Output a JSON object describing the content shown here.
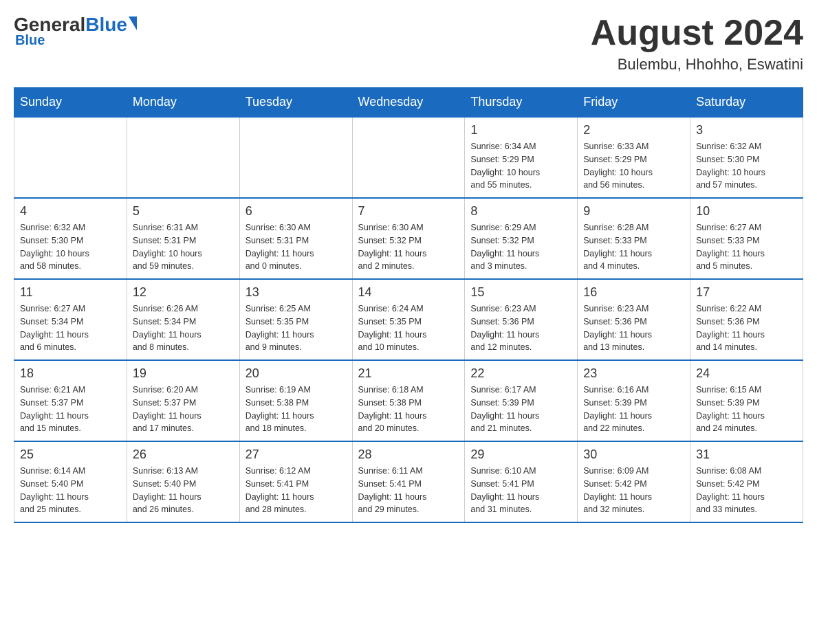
{
  "header": {
    "logo_general": "General",
    "logo_blue": "Blue",
    "month_title": "August 2024",
    "location": "Bulembu, Hhohho, Eswatini"
  },
  "days_of_week": [
    "Sunday",
    "Monday",
    "Tuesday",
    "Wednesday",
    "Thursday",
    "Friday",
    "Saturday"
  ],
  "weeks": [
    {
      "days": [
        {
          "num": "",
          "info": ""
        },
        {
          "num": "",
          "info": ""
        },
        {
          "num": "",
          "info": ""
        },
        {
          "num": "",
          "info": ""
        },
        {
          "num": "1",
          "info": "Sunrise: 6:34 AM\nSunset: 5:29 PM\nDaylight: 10 hours\nand 55 minutes."
        },
        {
          "num": "2",
          "info": "Sunrise: 6:33 AM\nSunset: 5:29 PM\nDaylight: 10 hours\nand 56 minutes."
        },
        {
          "num": "3",
          "info": "Sunrise: 6:32 AM\nSunset: 5:30 PM\nDaylight: 10 hours\nand 57 minutes."
        }
      ]
    },
    {
      "days": [
        {
          "num": "4",
          "info": "Sunrise: 6:32 AM\nSunset: 5:30 PM\nDaylight: 10 hours\nand 58 minutes."
        },
        {
          "num": "5",
          "info": "Sunrise: 6:31 AM\nSunset: 5:31 PM\nDaylight: 10 hours\nand 59 minutes."
        },
        {
          "num": "6",
          "info": "Sunrise: 6:30 AM\nSunset: 5:31 PM\nDaylight: 11 hours\nand 0 minutes."
        },
        {
          "num": "7",
          "info": "Sunrise: 6:30 AM\nSunset: 5:32 PM\nDaylight: 11 hours\nand 2 minutes."
        },
        {
          "num": "8",
          "info": "Sunrise: 6:29 AM\nSunset: 5:32 PM\nDaylight: 11 hours\nand 3 minutes."
        },
        {
          "num": "9",
          "info": "Sunrise: 6:28 AM\nSunset: 5:33 PM\nDaylight: 11 hours\nand 4 minutes."
        },
        {
          "num": "10",
          "info": "Sunrise: 6:27 AM\nSunset: 5:33 PM\nDaylight: 11 hours\nand 5 minutes."
        }
      ]
    },
    {
      "days": [
        {
          "num": "11",
          "info": "Sunrise: 6:27 AM\nSunset: 5:34 PM\nDaylight: 11 hours\nand 6 minutes."
        },
        {
          "num": "12",
          "info": "Sunrise: 6:26 AM\nSunset: 5:34 PM\nDaylight: 11 hours\nand 8 minutes."
        },
        {
          "num": "13",
          "info": "Sunrise: 6:25 AM\nSunset: 5:35 PM\nDaylight: 11 hours\nand 9 minutes."
        },
        {
          "num": "14",
          "info": "Sunrise: 6:24 AM\nSunset: 5:35 PM\nDaylight: 11 hours\nand 10 minutes."
        },
        {
          "num": "15",
          "info": "Sunrise: 6:23 AM\nSunset: 5:36 PM\nDaylight: 11 hours\nand 12 minutes."
        },
        {
          "num": "16",
          "info": "Sunrise: 6:23 AM\nSunset: 5:36 PM\nDaylight: 11 hours\nand 13 minutes."
        },
        {
          "num": "17",
          "info": "Sunrise: 6:22 AM\nSunset: 5:36 PM\nDaylight: 11 hours\nand 14 minutes."
        }
      ]
    },
    {
      "days": [
        {
          "num": "18",
          "info": "Sunrise: 6:21 AM\nSunset: 5:37 PM\nDaylight: 11 hours\nand 15 minutes."
        },
        {
          "num": "19",
          "info": "Sunrise: 6:20 AM\nSunset: 5:37 PM\nDaylight: 11 hours\nand 17 minutes."
        },
        {
          "num": "20",
          "info": "Sunrise: 6:19 AM\nSunset: 5:38 PM\nDaylight: 11 hours\nand 18 minutes."
        },
        {
          "num": "21",
          "info": "Sunrise: 6:18 AM\nSunset: 5:38 PM\nDaylight: 11 hours\nand 20 minutes."
        },
        {
          "num": "22",
          "info": "Sunrise: 6:17 AM\nSunset: 5:39 PM\nDaylight: 11 hours\nand 21 minutes."
        },
        {
          "num": "23",
          "info": "Sunrise: 6:16 AM\nSunset: 5:39 PM\nDaylight: 11 hours\nand 22 minutes."
        },
        {
          "num": "24",
          "info": "Sunrise: 6:15 AM\nSunset: 5:39 PM\nDaylight: 11 hours\nand 24 minutes."
        }
      ]
    },
    {
      "days": [
        {
          "num": "25",
          "info": "Sunrise: 6:14 AM\nSunset: 5:40 PM\nDaylight: 11 hours\nand 25 minutes."
        },
        {
          "num": "26",
          "info": "Sunrise: 6:13 AM\nSunset: 5:40 PM\nDaylight: 11 hours\nand 26 minutes."
        },
        {
          "num": "27",
          "info": "Sunrise: 6:12 AM\nSunset: 5:41 PM\nDaylight: 11 hours\nand 28 minutes."
        },
        {
          "num": "28",
          "info": "Sunrise: 6:11 AM\nSunset: 5:41 PM\nDaylight: 11 hours\nand 29 minutes."
        },
        {
          "num": "29",
          "info": "Sunrise: 6:10 AM\nSunset: 5:41 PM\nDaylight: 11 hours\nand 31 minutes."
        },
        {
          "num": "30",
          "info": "Sunrise: 6:09 AM\nSunset: 5:42 PM\nDaylight: 11 hours\nand 32 minutes."
        },
        {
          "num": "31",
          "info": "Sunrise: 6:08 AM\nSunset: 5:42 PM\nDaylight: 11 hours\nand 33 minutes."
        }
      ]
    }
  ]
}
